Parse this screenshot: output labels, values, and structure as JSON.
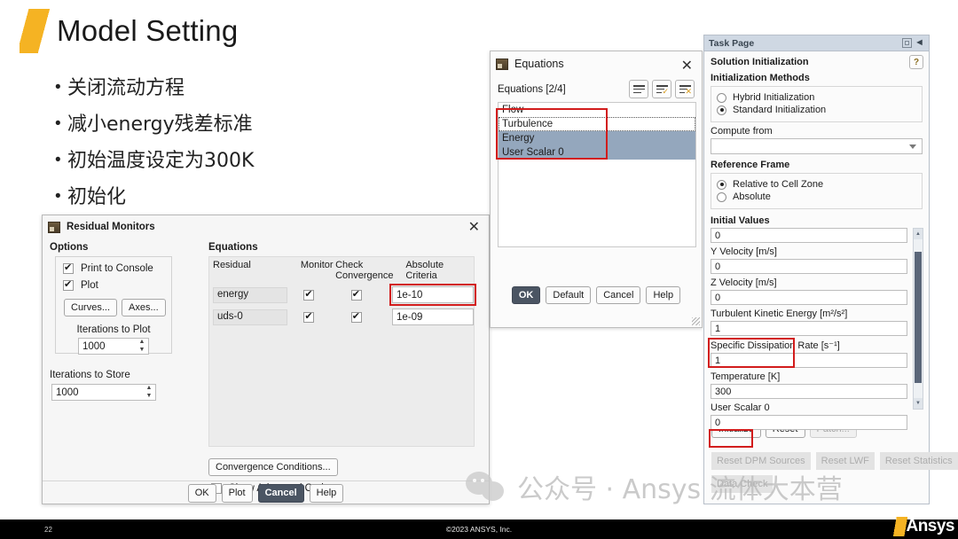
{
  "slide": {
    "title": "Model Setting",
    "bullets": [
      "关闭流动方程",
      "减小energy残差标准",
      "初始温度设定为300K",
      "初始化"
    ]
  },
  "residual_monitors": {
    "title": "Residual Monitors",
    "close_label": "✕",
    "options_label": "Options",
    "checkboxes": [
      {
        "label": "Print to Console",
        "checked": true
      },
      {
        "label": "Plot",
        "checked": true
      }
    ],
    "curves_label": "Curves...",
    "axes_label": "Axes...",
    "iterations_to_plot_label": "Iterations to Plot",
    "iterations_to_plot_value": "1000",
    "iterations_to_store_label": "Iterations to Store",
    "iterations_to_store_value": "1000",
    "equations_label": "Equations",
    "columns": {
      "residual": "Residual",
      "monitor": "Monitor",
      "check_convergence": "Check Convergence",
      "absolute_criteria": "Absolute Criteria"
    },
    "rows": [
      {
        "residual": "energy",
        "monitor": true,
        "check_convergence": true,
        "absolute_criteria": "1e-10",
        "highlighted": true
      },
      {
        "residual": "uds-0",
        "monitor": true,
        "check_convergence": true,
        "absolute_criteria": "1e-09",
        "highlighted": false
      }
    ],
    "convergence_conditions_label": "Convergence Conditions...",
    "show_advanced_label": "Show Advanced Options",
    "show_advanced_checked": false,
    "footer_buttons": [
      {
        "label": "OK",
        "primary": false
      },
      {
        "label": "Plot",
        "primary": false
      },
      {
        "label": "Cancel",
        "primary": true
      },
      {
        "label": "Help",
        "primary": false
      }
    ]
  },
  "equations_dialog": {
    "title": "Equations",
    "close_label": "✕",
    "count_label": "Equations  [2/4]",
    "toolbar": [
      {
        "name": "list-view-icon",
        "badge": ""
      },
      {
        "name": "select-all-icon",
        "badge": "✓"
      },
      {
        "name": "deselect-all-icon",
        "badge": "✕"
      }
    ],
    "items": [
      {
        "label": "Flow",
        "selected": false,
        "focused": false
      },
      {
        "label": "Turbulence",
        "selected": false,
        "focused": true
      },
      {
        "label": "Energy",
        "selected": true,
        "focused": false
      },
      {
        "label": "User Scalar 0",
        "selected": true,
        "focused": false
      }
    ],
    "footer_buttons": [
      {
        "label": "OK",
        "primary": true
      },
      {
        "label": "Default",
        "primary": false
      },
      {
        "label": "Cancel",
        "primary": false
      },
      {
        "label": "Help",
        "primary": false
      }
    ]
  },
  "task_page": {
    "header_title": "Task Page",
    "section_title": "Solution Initialization",
    "help_glyph": "?",
    "init_methods_label": "Initialization Methods",
    "init_methods": [
      {
        "label": "Hybrid  Initialization",
        "selected": false
      },
      {
        "label": "Standard Initialization",
        "selected": true
      }
    ],
    "compute_from_label": "Compute from",
    "compute_from_value": "",
    "reference_frame_label": "Reference Frame",
    "reference_frame": [
      {
        "label": "Relative to Cell Zone",
        "selected": true
      },
      {
        "label": "Absolute",
        "selected": false
      }
    ],
    "initial_values_label": "Initial Values",
    "fields": [
      {
        "label": "",
        "value": "0",
        "highlighted": false
      },
      {
        "label": "Y Velocity [m/s]",
        "value": "0",
        "highlighted": false
      },
      {
        "label": "Z Velocity [m/s]",
        "value": "0",
        "highlighted": false
      },
      {
        "label": "Turbulent Kinetic Energy [m²/s²]",
        "value": "1",
        "highlighted": false
      },
      {
        "label": "Specific Dissipation Rate [s⁻¹]",
        "value": "1",
        "highlighted": false
      },
      {
        "label": "Temperature [K]",
        "value": "300",
        "highlighted": true
      },
      {
        "label": "User Scalar 0",
        "value": "0",
        "highlighted": false
      }
    ],
    "action_buttons": [
      {
        "label": "Initialize",
        "disabled": false,
        "highlighted": true
      },
      {
        "label": "Reset",
        "disabled": false,
        "highlighted": false
      },
      {
        "label": "Patch...",
        "disabled": true,
        "highlighted": false
      }
    ],
    "reset_buttons": [
      {
        "label": "Reset DPM Sources"
      },
      {
        "label": "Reset LWF"
      },
      {
        "label": "Reset Statistics"
      }
    ],
    "data_check_label": "Data Check"
  },
  "watermark": {
    "text": "公众号 · Ansys 流体大本营"
  },
  "bottom_bar": {
    "page_number": "22",
    "copyright": "©2023 ANSYS, Inc.",
    "logo_text": "Ansys"
  },
  "colors": {
    "accent_yellow": "#F5B323",
    "highlight_red": "#d21c1c",
    "selection_blue": "#94a7bd",
    "primary_button": "#4b5563",
    "taskpage_header": "#cfd8e3"
  }
}
